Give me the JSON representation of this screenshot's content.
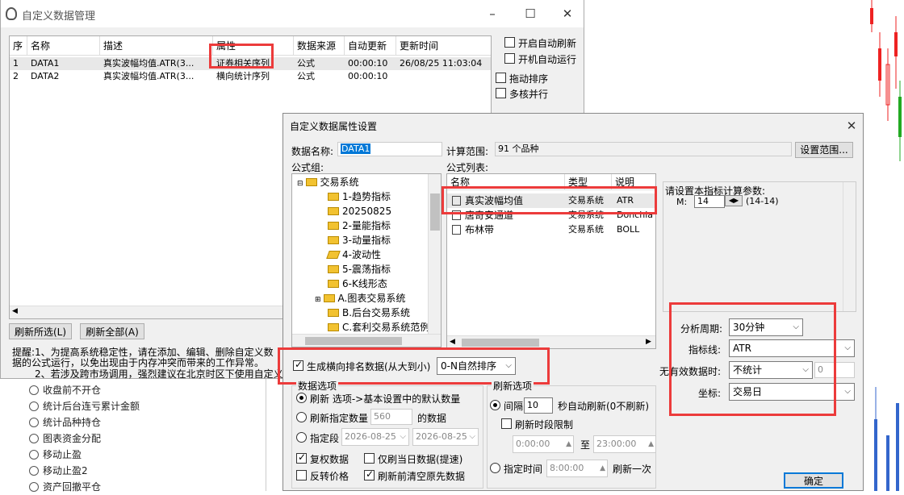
{
  "background": {
    "tree_items": [
      "收盘前不开仓",
      "统计后台连亏累计金额",
      "统计品种持仓",
      "图表资金分配",
      "移动止盈",
      "移动止盈2",
      "资产回撤平仓"
    ]
  },
  "win1": {
    "title": "自定义数据管理",
    "columns": [
      "序",
      "名称",
      "描述",
      "属性",
      "数据来源",
      "自动更新",
      "更新时间"
    ],
    "rows": [
      {
        "idx": "1",
        "name": "DATA1",
        "desc": "真实波幅均值.ATR(3...",
        "attr": "证券相关序列",
        "source": "公式",
        "auto": "00:00:10",
        "time": "26/08/25 11:03:04"
      },
      {
        "idx": "2",
        "name": "DATA2",
        "desc": "真实波幅均值.ATR(3...",
        "attr": "横向统计序列",
        "source": "公式",
        "auto": "00:00:10",
        "time": ""
      }
    ],
    "checks": [
      {
        "label": "开启自动刷新",
        "checked": false
      },
      {
        "label": "开机自动运行",
        "checked": false
      },
      {
        "label": "拖动排序",
        "checked": false
      },
      {
        "label": "多核并行",
        "checked": false
      }
    ],
    "refresh_selected": "刷新所选(L)",
    "refresh_all": "刷新全部(A)",
    "tip1": "提醒:1、为提高系统稳定性，请在添加、编辑、删除自定义数",
    "tip2": "据的公式运行，以免出现由于内存冲突而带来的工作异常。",
    "tip3": "2、若涉及跨市场调用，强烈建议在北京时区下使用自定义"
  },
  "win2": {
    "title": "自定义数据属性设置",
    "data_name_label": "数据名称:",
    "data_name_value": "DATA1",
    "calc_range_label": "计算范围:",
    "calc_range_value": "91 个品种",
    "set_range_button": "设置范围...",
    "formula_group_label": "公式组:",
    "formula_list_label": "公式列表:",
    "tree": [
      {
        "label": "交易系统",
        "level": 0
      },
      {
        "label": "1-趋势指标",
        "level": 1
      },
      {
        "label": "20250825",
        "level": 1
      },
      {
        "label": "2-量能指标",
        "level": 1
      },
      {
        "label": "3-动量指标",
        "level": 1
      },
      {
        "label": "4-波动性",
        "level": 1
      },
      {
        "label": "5-震荡指标",
        "level": 1
      },
      {
        "label": "6-K线形态",
        "level": 1
      },
      {
        "label": "A.图表交易系统",
        "level": 1
      },
      {
        "label": "B.后台交易系统",
        "level": 1
      },
      {
        "label": "C.套利交易系统范例",
        "level": 1
      }
    ],
    "list_columns": [
      "名称",
      "类型",
      "说明"
    ],
    "list_rows": [
      {
        "name": "真实波幅均值",
        "type": "交易系统",
        "desc": "ATR"
      },
      {
        "name": "唐奇安通道",
        "type": "交易系统",
        "desc": "Donchian"
      },
      {
        "name": "布林带",
        "type": "交易系统",
        "desc": "BOLL"
      }
    ],
    "param_title": "请设置本指标计算参数:",
    "param_name": "M:",
    "param_value": "14",
    "param_range": "(14-14)",
    "period_label": "分析周期:",
    "period_value": "30分钟",
    "indicator_label": "指标线:",
    "indicator_value": "ATR",
    "invalid_label": "无有效数据时:",
    "invalid_value": "不统计",
    "invalid_num": "0",
    "coord_label": "坐标:",
    "coord_value": "交易日",
    "gen_rank_label": "生成横向排名数据(从大到小)",
    "gen_rank_checked": true,
    "rank_value": "0-N自然排序",
    "data_opt_title": "数据选项",
    "refresh_opt_title": "刷新选项",
    "radio_default": "刷新 选项->基本设置中的默认数量",
    "radio_count": "刷新指定数量",
    "count_value": "560",
    "count_suffix": "的数据",
    "radio_range": "指定段",
    "date_from": "2026-08-25",
    "date_to": "2026-08-25",
    "cb_restore": "复权数据",
    "cb_today": "仅刷当日数据(提速)",
    "cb_reverse": "反转价格",
    "cb_clear": "刷新前清空原先数据",
    "radio_interval": "间隔",
    "interval_value": "10",
    "interval_suffix": "秒自动刷新(0不刷新)",
    "cb_period_limit": "刷新时段限制",
    "time_from": "0:00:00",
    "time_to_label": "至",
    "time_to": "23:00:00",
    "radio_fixed": "指定时间",
    "fixed_time": "8:00:00",
    "fixed_suffix": "刷新一次",
    "ok_button": "确定"
  }
}
